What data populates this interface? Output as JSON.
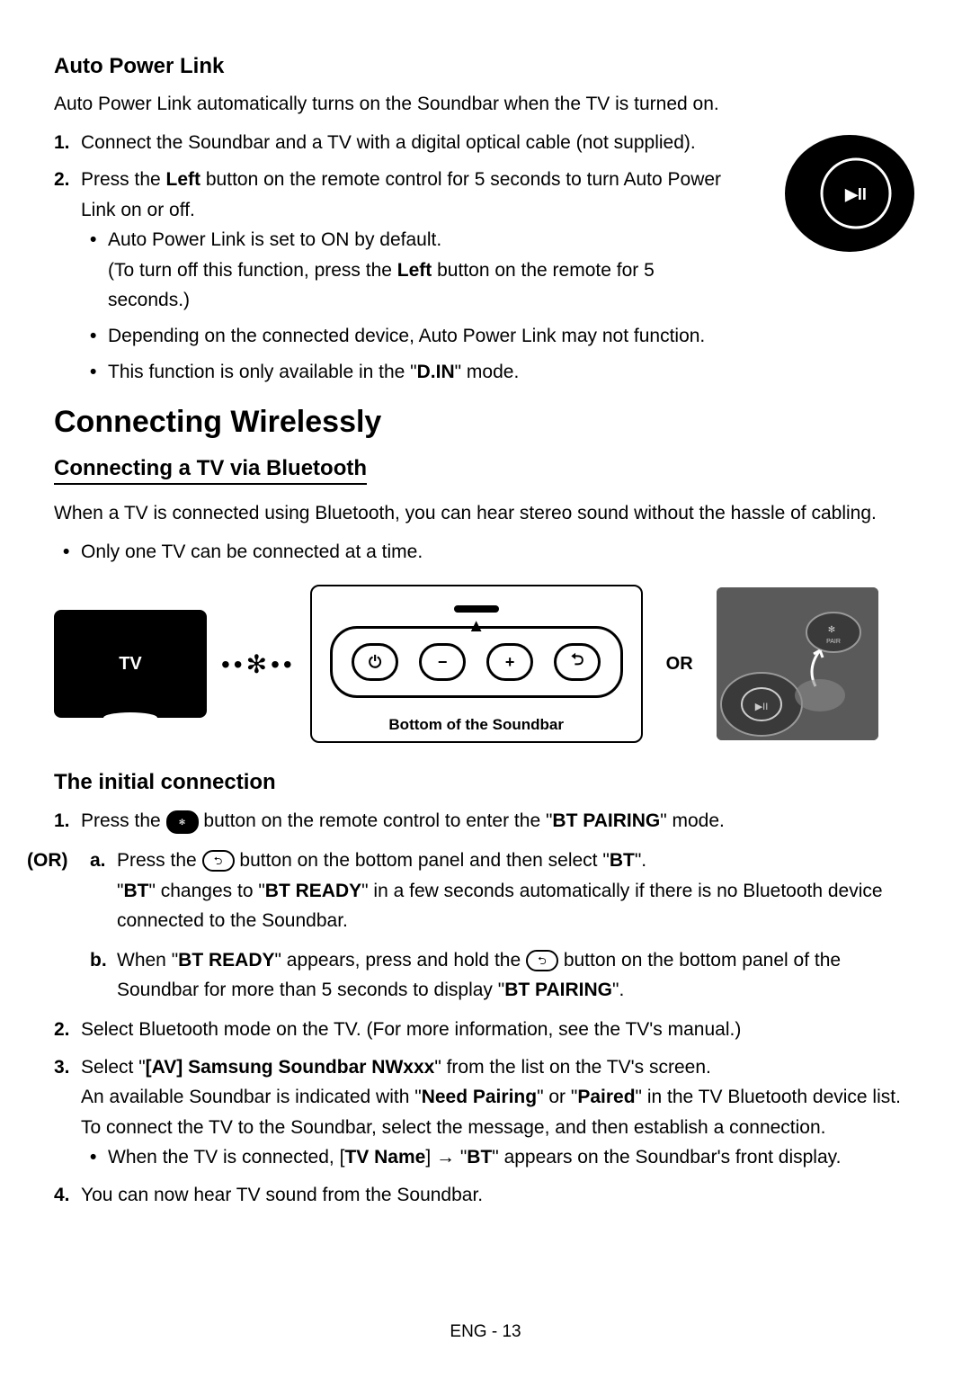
{
  "autoPowerLink": {
    "heading": "Auto Power Link",
    "intro": "Auto Power Link automatically turns on the Soundbar when the TV is turned on.",
    "step1_num": "1.",
    "step1": "Connect the Soundbar and a TV with a digital optical cable (not supplied).",
    "step2_num": "2.",
    "step2_a": "Press the ",
    "step2_bold": "Left",
    "step2_b": " button on the remote control for 5 seconds to turn Auto Power Link on or off.",
    "bullet1_a": "Auto Power Link is set to ON by default.",
    "bullet1_b_pre": "(To turn off this function, press the ",
    "bullet1_b_bold": "Left",
    "bullet1_b_post": " button on the remote for 5 seconds.)",
    "bullet2": "Depending on the connected device, Auto Power Link may not function.",
    "bullet3_pre": "This function is only available in the \"",
    "bullet3_bold": "D.IN",
    "bullet3_post": "\" mode."
  },
  "connectingWirelessly": {
    "heading": "Connecting Wirelessly",
    "subHeading": "Connecting a TV via Bluetooth",
    "intro": "When a TV is connected using Bluetooth, you can hear stereo sound without the hassle of cabling.",
    "bullet1": "Only one TV can be connected at a time."
  },
  "diagram": {
    "tvLabel": "TV",
    "btDots": "••✻••",
    "soundbarCaption": "Bottom of the Soundbar",
    "orLabel": "OR"
  },
  "initialConnection": {
    "heading": "The initial connection",
    "step1_num": "1.",
    "step1_pre": "Press the ",
    "step1_post": " button on the remote control to enter the \"",
    "step1_bold": "BT PAIRING",
    "step1_end": "\" mode.",
    "orLabel": "(OR)",
    "a_letter": "a.",
    "a_pre": "Press the ",
    "a_mid": " button on the bottom panel and then select \"",
    "a_bold1": "BT",
    "a_post1": "\".",
    "a_line2_pre": "\"",
    "a_line2_bold1": "BT",
    "a_line2_mid": "\" changes to \"",
    "a_line2_bold2": "BT READY",
    "a_line2_post": "\" in a few seconds automatically if there is no Bluetooth device connected to the Soundbar.",
    "b_letter": "b.",
    "b_pre": "When \"",
    "b_bold1": "BT READY",
    "b_mid1": "\" appears, press and hold the ",
    "b_mid2": " button on the bottom panel of the Soundbar for more than 5 seconds to display \"",
    "b_bold2": "BT PAIRING",
    "b_end": "\".",
    "step2_num": "2.",
    "step2": "Select Bluetooth mode on the TV. (For more information, see the TV's manual.)",
    "step3_num": "3.",
    "step3_pre": "Select \"",
    "step3_bold1": "[AV] Samsung Soundbar NWxxx",
    "step3_mid1": "\" from the list on the TV's screen.",
    "step3_line2_pre": "An available Soundbar is indicated with \"",
    "step3_line2_bold1": "Need Pairing",
    "step3_line2_mid": "\" or \"",
    "step3_line2_bold2": "Paired",
    "step3_line2_post": "\" in the TV Bluetooth device list. To connect the TV to the Soundbar, select the message, and then establish a connection.",
    "step3_bullet_pre": "When the TV is connected, [",
    "step3_bullet_bold1": "TV Name",
    "step3_bullet_mid": "] → \"",
    "step3_bullet_bold2": "BT",
    "step3_bullet_post": "\" appears on the Soundbar's front display.",
    "step4_num": "4.",
    "step4": "You can now hear TV sound from the Soundbar."
  },
  "footer": "ENG - 13"
}
